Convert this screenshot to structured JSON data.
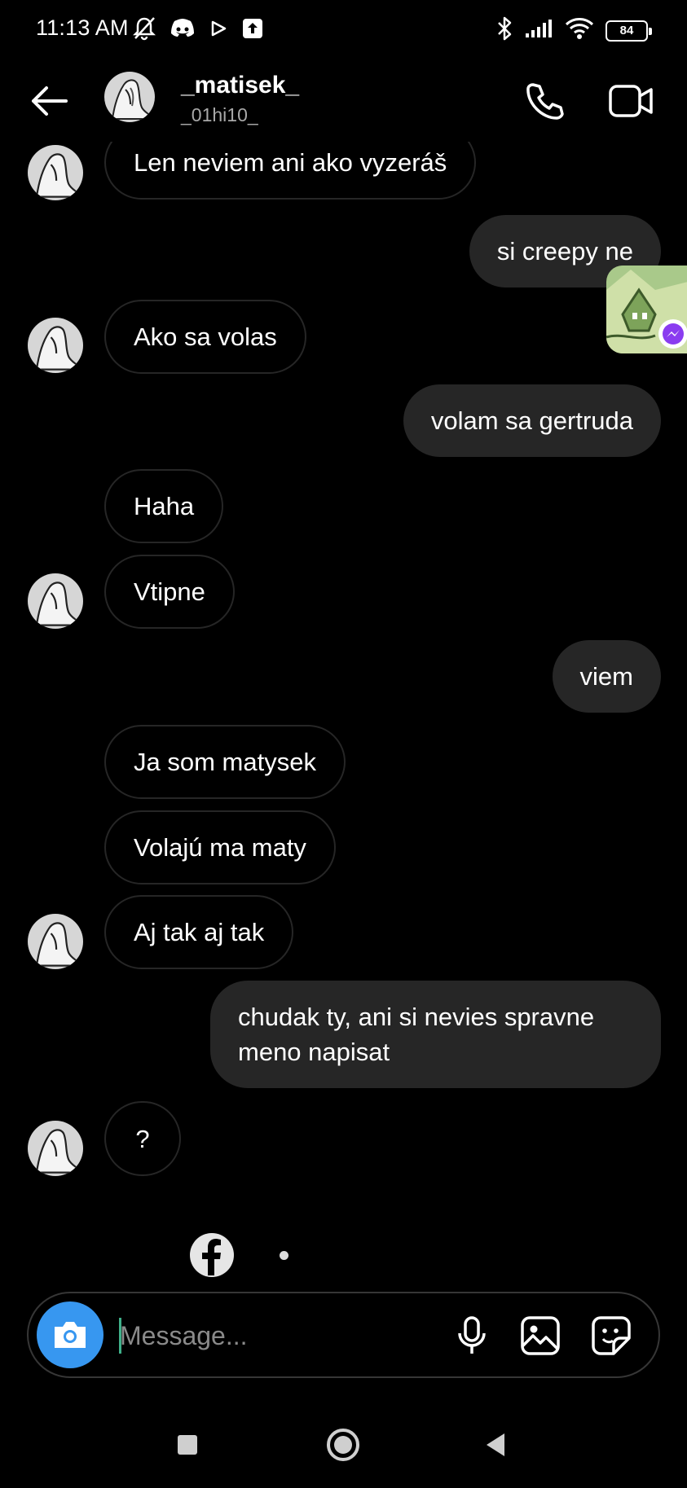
{
  "status_bar": {
    "time": "11:13 AM",
    "battery": "84",
    "left_icons": [
      "mute-bell-icon",
      "discord-icon",
      "play-icon",
      "upload-icon"
    ],
    "right_icons": [
      "bluetooth-icon",
      "signal-icon",
      "wifi-icon",
      "battery-icon"
    ]
  },
  "header": {
    "name": "_matisek_",
    "username": "_01hi10_",
    "icons": [
      "back-arrow-icon",
      "phone-icon",
      "video-camera-icon"
    ]
  },
  "messages": [
    {
      "from": "them",
      "text": "Len neviem ani ako vyzeráš",
      "avatar": true
    },
    {
      "from": "me",
      "text": "si creepy ne"
    },
    {
      "from": "them",
      "text": "Ako sa volas",
      "avatar": true
    },
    {
      "from": "me",
      "text": "volam sa gertruda"
    },
    {
      "from": "them",
      "text": "Haha",
      "avatar": false
    },
    {
      "from": "them",
      "text": "Vtipne",
      "avatar": true
    },
    {
      "from": "me",
      "text": "viem"
    },
    {
      "from": "them",
      "text": "Ja som matysek",
      "avatar": false
    },
    {
      "from": "them",
      "text": "Volajú ma maty",
      "avatar": false
    },
    {
      "from": "them",
      "text": "Aj tak aj tak",
      "avatar": true
    },
    {
      "from": "me",
      "text": "chudak ty, ani si nevies spravne meno napisat"
    },
    {
      "from": "them",
      "text": "?",
      "avatar": true
    }
  ],
  "composer": {
    "placeholder": "Message...",
    "icons": [
      "camera-icon",
      "microphone-icon",
      "gallery-icon",
      "sticker-icon"
    ]
  },
  "colors": {
    "background": "#000000",
    "outgoing_bubble": "#262626",
    "incoming_border": "#262626",
    "camera_button": "#3797f0",
    "secondary_text": "#a8a8a8"
  },
  "nav_icons": [
    "recents-square-icon",
    "home-circle-icon",
    "back-triangle-icon"
  ]
}
